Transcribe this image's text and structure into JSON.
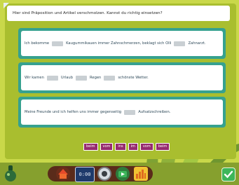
{
  "instruction": "Hier sind Präposition und Artikel verschmolzen. Kannst du richtig einsetzen?",
  "exercises": [
    {
      "parts": [
        "Ich bekomme",
        "Kaugummikauen immer Zahnschmerzen, beklagt sich Olli",
        "Zahnarzt."
      ]
    },
    {
      "parts": [
        "Wir kamen",
        "Urlaub",
        "Regen",
        "schönste Wetter."
      ]
    },
    {
      "parts": [
        "Meine Freunde und ich helfen uns immer gegenseitig",
        "Aufsatzschreiben."
      ]
    }
  ],
  "answer_chips": [
    "beim",
    "vom",
    "ins",
    "im",
    "vom",
    "beim"
  ],
  "toolbar": {
    "timer_label": "0:00"
  },
  "colors": {
    "background": "#c9d84a",
    "frame": "#a9be2f",
    "card_border": "#36a18f",
    "chip": "#962a6e",
    "toolbar": "#5a2b1a",
    "confirm": "#3db65a"
  }
}
